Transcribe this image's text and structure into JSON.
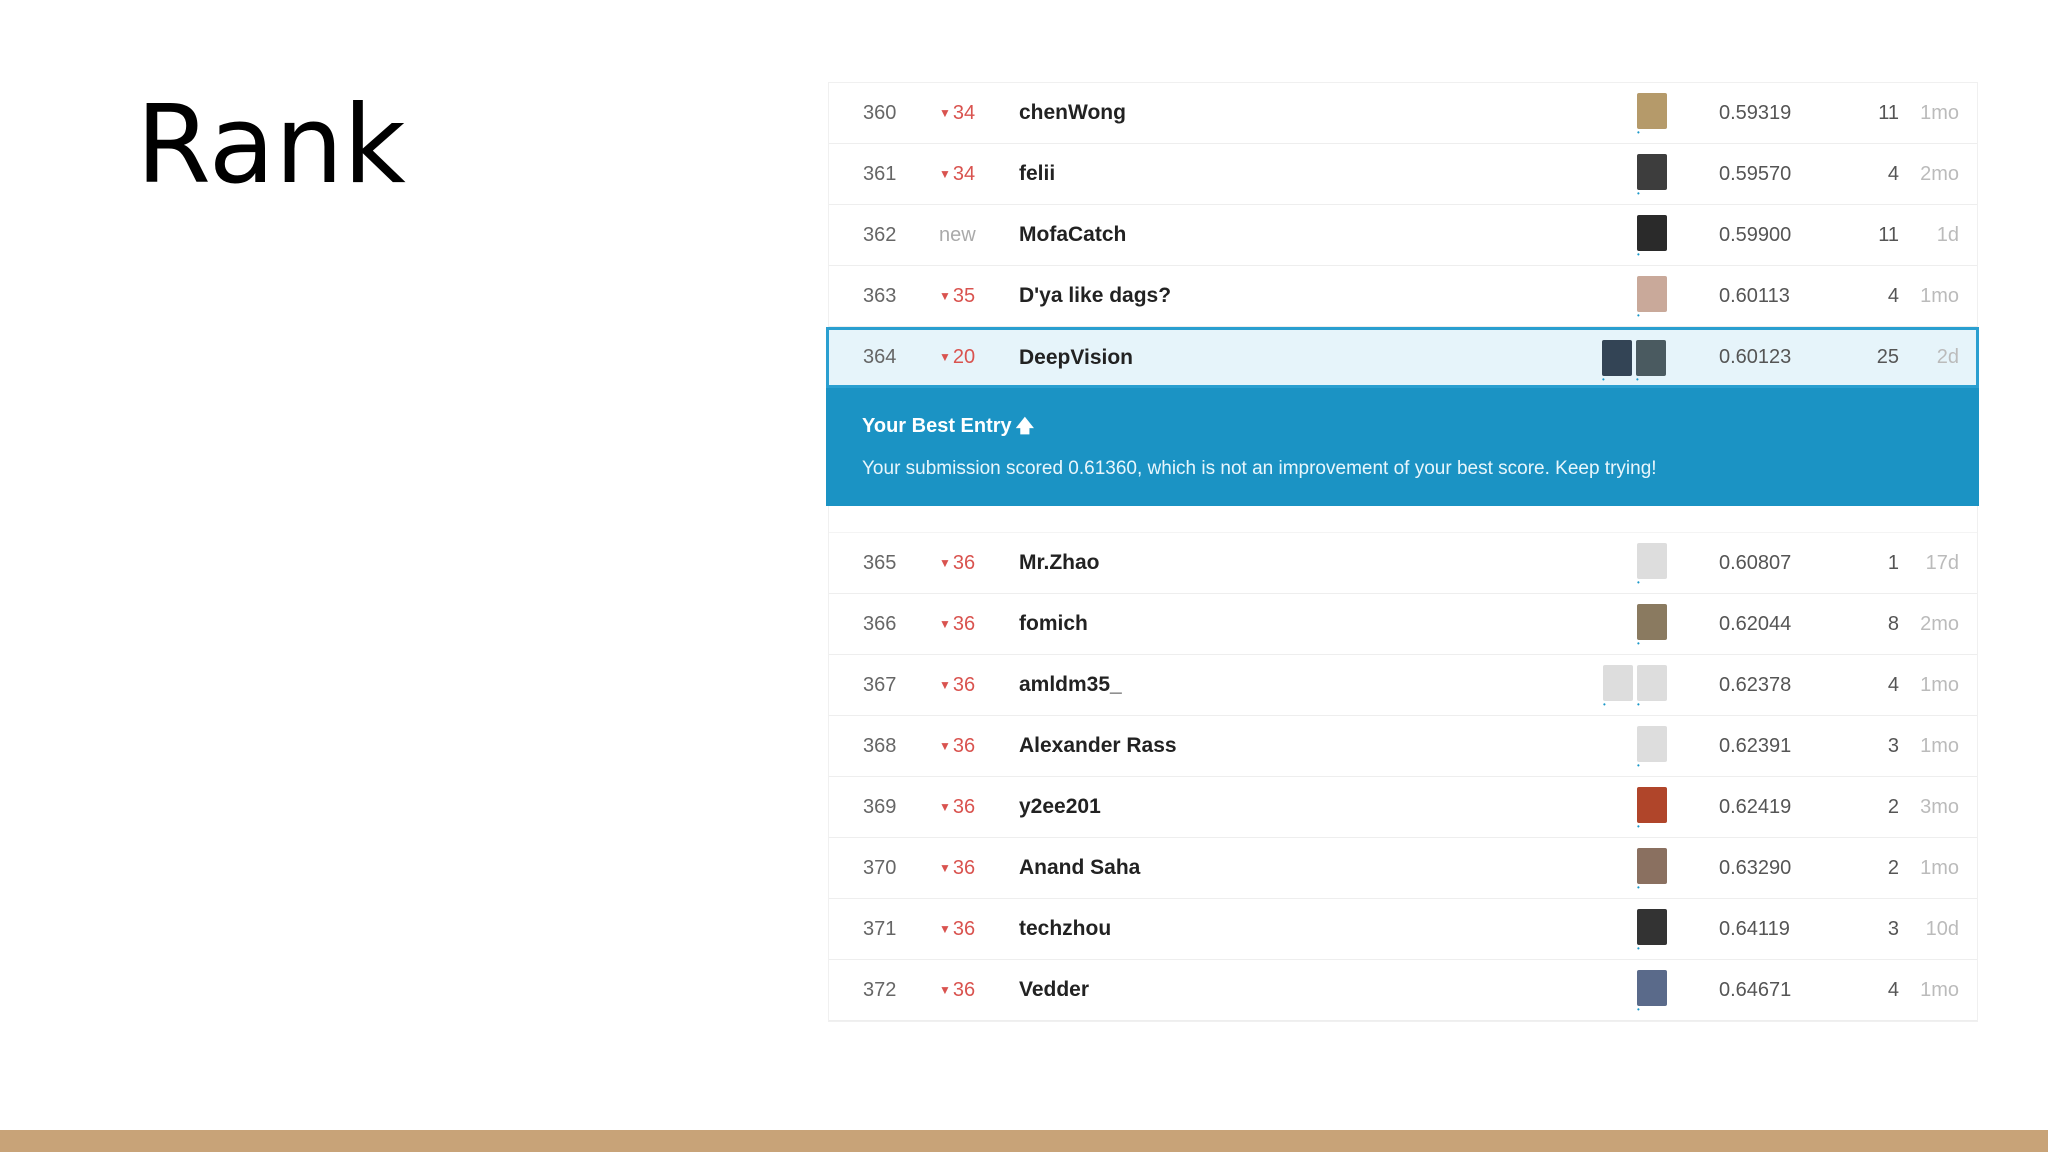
{
  "slide": {
    "title": "Rank",
    "footer_color": "#c8a378"
  },
  "leaderboard": {
    "rows_above": [
      {
        "rank": "360",
        "delta": "34",
        "new": false,
        "name": "chenWong",
        "avatars": [
          {
            "color": "#b59a6a"
          }
        ],
        "score": "0.59319",
        "entries": "11",
        "last": "1mo"
      },
      {
        "rank": "361",
        "delta": "34",
        "new": false,
        "name": "felii",
        "avatars": [
          {
            "color": "#3d3d3d"
          }
        ],
        "score": "0.59570",
        "entries": "4",
        "last": "2mo"
      },
      {
        "rank": "362",
        "delta": "new",
        "new": true,
        "name": "MofaCatch",
        "avatars": [
          {
            "color": "#2a2a2a"
          }
        ],
        "score": "0.59900",
        "entries": "11",
        "last": "1d"
      },
      {
        "rank": "363",
        "delta": "35",
        "new": false,
        "name": "D'ya like dags?",
        "avatars": [
          {
            "color": "#c9a99a"
          }
        ],
        "score": "0.60113",
        "entries": "4",
        "last": "1mo"
      }
    ],
    "highlight_row": {
      "rank": "364",
      "delta": "20",
      "new": false,
      "name": "DeepVision",
      "avatars": [
        {
          "color": "#334455"
        },
        {
          "color": "#4a5a60"
        }
      ],
      "score": "0.60123",
      "entries": "25",
      "last": "2d"
    },
    "best_entry": {
      "title": "Your Best Entry",
      "message": "Your submission scored 0.61360, which is not an improvement of your best score. Keep trying!"
    },
    "rows_below": [
      {
        "rank": "365",
        "delta": "36",
        "new": false,
        "name": "Mr.Zhao",
        "avatars": [
          {
            "color": "#dddddd"
          }
        ],
        "score": "0.60807",
        "entries": "1",
        "last": "17d"
      },
      {
        "rank": "366",
        "delta": "36",
        "new": false,
        "name": "fomich",
        "avatars": [
          {
            "color": "#8a7a60"
          }
        ],
        "score": "0.62044",
        "entries": "8",
        "last": "2mo"
      },
      {
        "rank": "367",
        "delta": "36",
        "new": false,
        "name": "amldm35_",
        "avatars": [
          {
            "color": "#dddddd"
          },
          {
            "color": "#dddddd"
          }
        ],
        "score": "0.62378",
        "entries": "4",
        "last": "1mo"
      },
      {
        "rank": "368",
        "delta": "36",
        "new": false,
        "name": "Alexander Rass",
        "avatars": [
          {
            "color": "#dddddd"
          }
        ],
        "score": "0.62391",
        "entries": "3",
        "last": "1mo"
      },
      {
        "rank": "369",
        "delta": "36",
        "new": false,
        "name": "y2ee201",
        "avatars": [
          {
            "color": "#b0452a"
          }
        ],
        "score": "0.62419",
        "entries": "2",
        "last": "3mo"
      },
      {
        "rank": "370",
        "delta": "36",
        "new": false,
        "name": "Anand Saha",
        "avatars": [
          {
            "color": "#8a7060"
          }
        ],
        "score": "0.63290",
        "entries": "2",
        "last": "1mo"
      },
      {
        "rank": "371",
        "delta": "36",
        "new": false,
        "name": "techzhou",
        "avatars": [
          {
            "color": "#333333"
          }
        ],
        "score": "0.64119",
        "entries": "3",
        "last": "10d"
      },
      {
        "rank": "372",
        "delta": "36",
        "new": false,
        "name": "Vedder",
        "avatars": [
          {
            "color": "#5a6a8a"
          }
        ],
        "score": "0.64671",
        "entries": "4",
        "last": "1mo"
      }
    ]
  }
}
